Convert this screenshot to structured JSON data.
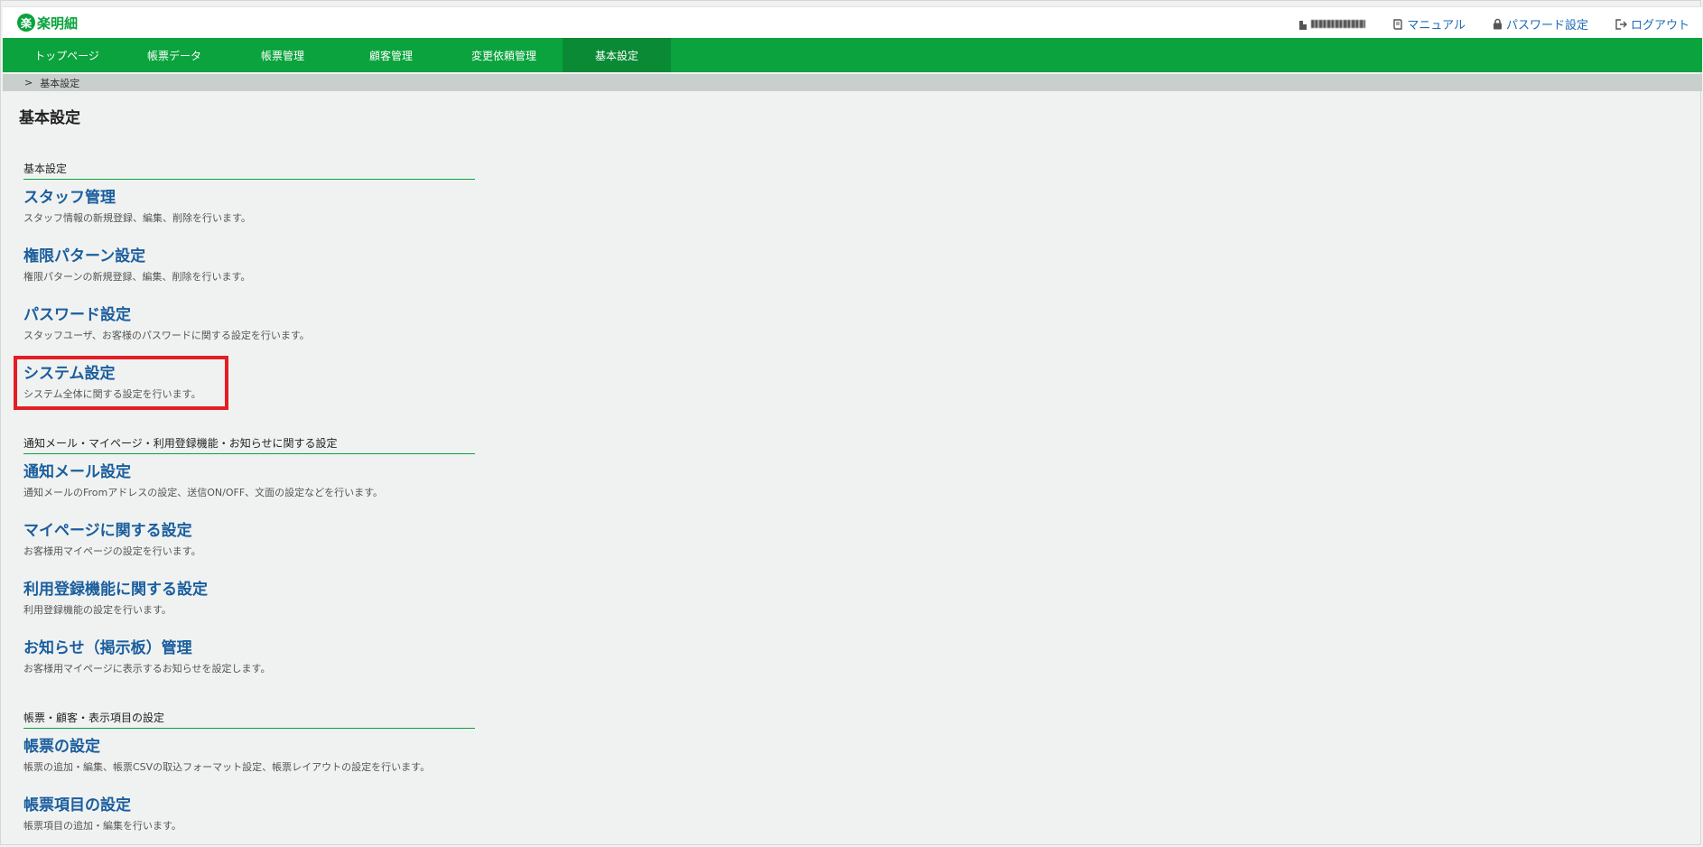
{
  "app": {
    "logo_mark": "楽",
    "logo_text": "楽明細"
  },
  "header": {
    "user_name": "",
    "manual": "マニュアル",
    "password": "パスワード設定",
    "logout": "ログアウト"
  },
  "nav": [
    {
      "label": "トップページ"
    },
    {
      "label": "帳票データ"
    },
    {
      "label": "帳票管理"
    },
    {
      "label": "顧客管理"
    },
    {
      "label": "変更依頼管理"
    },
    {
      "label": "基本設定",
      "active": true
    }
  ],
  "breadcrumb": {
    "sep": ">",
    "current": "基本設定"
  },
  "page_title": "基本設定",
  "sections": [
    {
      "heading": "基本設定",
      "items": [
        {
          "title": "スタッフ管理",
          "desc": "スタッフ情報の新規登録、編集、削除を行います。"
        },
        {
          "title": "権限パターン設定",
          "desc": "権限パターンの新規登録、編集、削除を行います。"
        },
        {
          "title": "パスワード設定",
          "desc": "スタッフユーザ、お客様のパスワードに関する設定を行います。"
        },
        {
          "title": "システム設定",
          "desc": "システム全体に関する設定を行います。"
        }
      ]
    },
    {
      "heading": "通知メール・マイページ・利用登録機能・お知らせに関する設定",
      "items": [
        {
          "title": "通知メール設定",
          "desc": "通知メールのFromアドレスの設定、送信ON/OFF、文面の設定などを行います。"
        },
        {
          "title": "マイページに関する設定",
          "desc": "お客様用マイページの設定を行います。"
        },
        {
          "title": "利用登録機能に関する設定",
          "desc": "利用登録機能の設定を行います。"
        },
        {
          "title": "お知らせ（掲示板）管理",
          "desc": "お客様用マイページに表示するお知らせを設定します。"
        }
      ]
    },
    {
      "heading": "帳票・顧客・表示項目の設定",
      "items": [
        {
          "title": "帳票の設定",
          "desc": "帳票の追加・編集、帳票CSVの取込フォーマット設定、帳票レイアウトの設定を行います。"
        },
        {
          "title": "帳票項目の設定",
          "desc": "帳票項目の追加・編集を行います。"
        }
      ]
    }
  ],
  "colors": {
    "brand_green": "#0aa33d",
    "link_blue": "#1a5e9e",
    "highlight_red": "#e31e24"
  }
}
